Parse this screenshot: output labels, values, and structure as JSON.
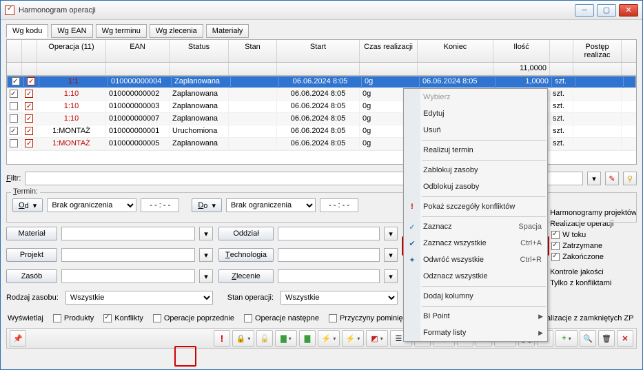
{
  "window": {
    "title": "Harmonogram operacji"
  },
  "tabs": [
    "Wg kodu",
    "Wg EAN",
    "Wg terminu",
    "Wg zlecenia",
    "Materiały"
  ],
  "active_tab": 0,
  "columns": [
    "",
    "",
    "Operacja (11)",
    "EAN",
    "Status",
    "Stan",
    "Start",
    "Czas realizacji",
    "Koniec",
    "Ilość",
    "",
    "Postęp realizac"
  ],
  "ilosc_sub": "11,0000",
  "rows": [
    {
      "c1": true,
      "c2": true,
      "op": "1:1",
      "red": true,
      "ean": "010000000004",
      "status": "Zaplanowana",
      "stan": "",
      "start": "06.06.2024  8:05",
      "cr": "0g",
      "koniec": "06.06.2024  8:05",
      "il": "1,0000",
      "j": "szt.",
      "sel": true
    },
    {
      "c1": true,
      "c2": true,
      "op": "1:10",
      "red": true,
      "ean": "010000000002",
      "status": "Zaplanowana",
      "stan": "",
      "start": "06.06.2024  8:05",
      "cr": "0g",
      "koniec": "",
      "il": "",
      "j": "szt."
    },
    {
      "c1": false,
      "c2": true,
      "op": "1:10",
      "red": true,
      "ean": "010000000003",
      "status": "Zaplanowana",
      "stan": "",
      "start": "06.06.2024  8:05",
      "cr": "0g",
      "koniec": "",
      "il": "",
      "j": "szt."
    },
    {
      "c1": false,
      "c2": true,
      "op": "1:10",
      "red": true,
      "ean": "010000000007",
      "status": "Zaplanowana",
      "stan": "",
      "start": "06.06.2024  8:05",
      "cr": "0g",
      "koniec": "",
      "il": "",
      "j": "szt."
    },
    {
      "c1": true,
      "c2": true,
      "op": "1:MONTAŻ",
      "red": false,
      "ean": "010000000001",
      "status": "Uruchomiona",
      "stan": "",
      "start": "06.06.2024  8:05",
      "cr": "0g",
      "koniec": "",
      "il": "",
      "j": "szt."
    },
    {
      "c1": false,
      "c2": true,
      "op": "1:MONTAŻ",
      "red": true,
      "ean": "010000000005",
      "status": "Zaplanowana",
      "stan": "",
      "start": "06.06.2024  8:05",
      "cr": "0g",
      "koniec": "",
      "il": "",
      "j": "szt."
    }
  ],
  "filtr_label": "Filtr:",
  "termin": {
    "legend": "Termin:",
    "od": "Od",
    "do": "Do",
    "brak": "Brak ograniczenia",
    "time": "- - : - -"
  },
  "form": {
    "material": "Materiał",
    "projekt": "Projekt",
    "zasob": "Zasób",
    "oddzial": "Oddział",
    "technologia": "Technologia",
    "zlecenie": "Zlecenie",
    "rodzaj": "Rodzaj zasobu:",
    "rodzaj_val": "Wszystkie",
    "stan": "Stan operacji:",
    "stan_val": "Wszystkie"
  },
  "right_checks": {
    "harm": "Harmonogramy projektów",
    "real": "Realizacje operacji",
    "wtoku": "W toku",
    "zatrz": "Zatrzymane",
    "zak": "Zakończone",
    "kj": "Kontrole jakości",
    "tzk": "Tylko z konfliktami"
  },
  "wyswietlaj": {
    "legend": "Wyświetlaj",
    "produkty": "Produkty",
    "konflikty": "Konflikty",
    "op_pop": "Operacje poprzednie",
    "op_nast": "Operacje następne",
    "przyczyny": "Przyczyny pominięcia operacji",
    "pokaz": "Pokaż operacje/realizacje z zamkniętych ZP"
  },
  "ctx": {
    "wybierz": "Wybierz",
    "edytuj": "Edytuj",
    "usun": "Usuń",
    "realizuj": "Realizuj termin",
    "zablokuj": "Zablokuj zasoby",
    "odblokuj": "Odblokuj zasoby",
    "pokaz": "Pokaż szczegóły konfliktów",
    "zaznacz": "Zaznacz",
    "zaz_w": "Zaznacz wszystkie",
    "odw_w": "Odwróć wszystkie",
    "odz_w": "Odznacz wszystkie",
    "dodaj": "Dodaj kolumny",
    "bi": "BI Point",
    "formaty": "Formaty listy",
    "sc_spacja": "Spacja",
    "sc_ctrla": "Ctrl+A",
    "sc_ctrlr": "Ctrl+R"
  }
}
